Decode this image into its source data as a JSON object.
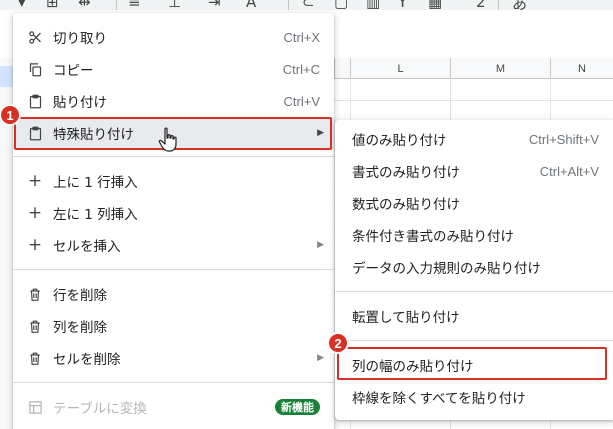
{
  "toolbar": {
    "text_icons": [
      "Y",
      "2",
      "あ"
    ]
  },
  "sheet": {
    "columns": [
      "L",
      "M",
      "N"
    ]
  },
  "main_menu": {
    "items": [
      {
        "label": "切り取り",
        "shortcut": "Ctrl+X",
        "icon": "scissors-icon"
      },
      {
        "label": "コピー",
        "shortcut": "Ctrl+C",
        "icon": "copy-icon"
      },
      {
        "label": "貼り付け",
        "shortcut": "Ctrl+V",
        "icon": "clipboard-icon"
      },
      {
        "label": "特殊貼り付け",
        "icon": "clipboard-icon",
        "submenu": true
      },
      {
        "label": "上に 1 行挿入",
        "icon": "plus-icon"
      },
      {
        "label": "左に 1 列挿入",
        "icon": "plus-icon"
      },
      {
        "label": "セルを挿入",
        "icon": "plus-icon",
        "submenu": true
      },
      {
        "label": "行を削除",
        "icon": "trash-icon"
      },
      {
        "label": "列を削除",
        "icon": "trash-icon"
      },
      {
        "label": "セルを削除",
        "icon": "trash-icon",
        "submenu": true
      },
      {
        "label": "テーブルに変換",
        "icon": "table-icon",
        "disabled": true,
        "badge": "新機能"
      }
    ]
  },
  "sub_menu": {
    "items": [
      {
        "label": "値のみ貼り付け",
        "shortcut": "Ctrl+Shift+V"
      },
      {
        "label": "書式のみ貼り付け",
        "shortcut": "Ctrl+Alt+V"
      },
      {
        "label": "数式のみ貼り付け"
      },
      {
        "label": "条件付き書式のみ貼り付け"
      },
      {
        "label": "データの入力規則のみ貼り付け"
      },
      {
        "label": "転置して貼り付け"
      },
      {
        "label": "列の幅のみ貼り付け"
      },
      {
        "label": "枠線を除くすべてを貼り付け"
      }
    ]
  },
  "callouts": [
    "1",
    "2"
  ],
  "colors": {
    "accent_red": "#d93025",
    "badge_green": "#188038",
    "highlight": "#e8eaed"
  }
}
